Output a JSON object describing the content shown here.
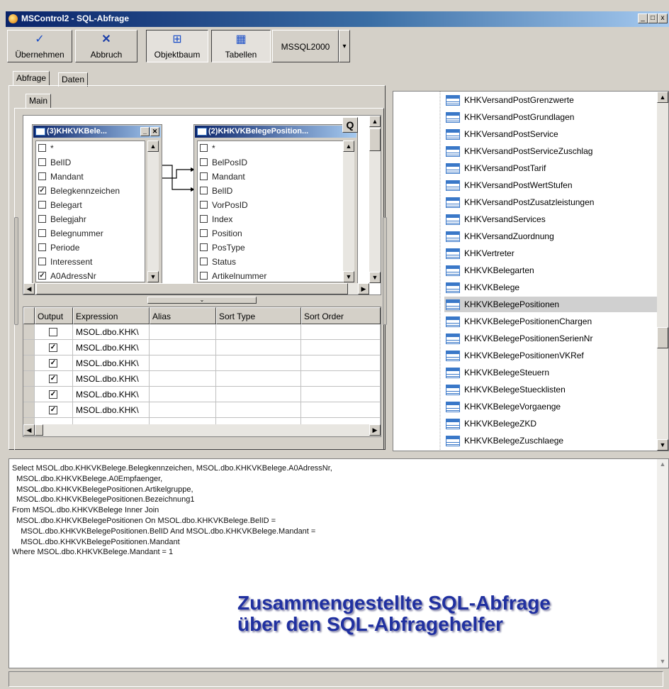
{
  "window": {
    "title": "MSControl2 - SQL-Abfrage",
    "min": "_",
    "max": "□",
    "close": "x"
  },
  "toolbar": {
    "apply_label": "Übernehmen",
    "cancel_label": "Abbruch",
    "objtree_label": "Objektbaum",
    "tables_label": "Tabellen",
    "db_value": "MSSQL2000",
    "dropdown_glyph": "▾"
  },
  "tabs": {
    "query": "Abfrage",
    "data": "Daten"
  },
  "inner_tab": "Main",
  "query_button": "Q",
  "table1": {
    "title": "(3)KHKVKBele...",
    "fields": [
      {
        "name": "*",
        "checked": false
      },
      {
        "name": "BelID",
        "checked": false
      },
      {
        "name": "Mandant",
        "checked": false
      },
      {
        "name": "Belegkennzeichen",
        "checked": true
      },
      {
        "name": "Belegart",
        "checked": false
      },
      {
        "name": "Belegjahr",
        "checked": false
      },
      {
        "name": "Belegnummer",
        "checked": false
      },
      {
        "name": "Periode",
        "checked": false
      },
      {
        "name": "Interessent",
        "checked": false
      },
      {
        "name": "A0AdressNr",
        "checked": true
      }
    ]
  },
  "table2": {
    "title": "(2)KHKVKBelegePosition...",
    "fields": [
      {
        "name": "*",
        "checked": false
      },
      {
        "name": "BelPosID",
        "checked": false
      },
      {
        "name": "Mandant",
        "checked": false
      },
      {
        "name": "BelID",
        "checked": false
      },
      {
        "name": "VorPosID",
        "checked": false
      },
      {
        "name": "Index",
        "checked": false
      },
      {
        "name": "Position",
        "checked": false
      },
      {
        "name": "PosType",
        "checked": false
      },
      {
        "name": "Status",
        "checked": false
      },
      {
        "name": "Artikelnummer",
        "checked": false
      }
    ]
  },
  "grid": {
    "columns": [
      "Output",
      "Expression",
      "Alias",
      "Sort Type",
      "Sort Order"
    ],
    "rows": [
      {
        "output": false,
        "expression": "MSOL.dbo.KHK\\"
      },
      {
        "output": true,
        "expression": "MSOL.dbo.KHK\\"
      },
      {
        "output": true,
        "expression": "MSOL.dbo.KHK\\"
      },
      {
        "output": true,
        "expression": "MSOL.dbo.KHK\\"
      },
      {
        "output": true,
        "expression": "MSOL.dbo.KHK\\"
      },
      {
        "output": true,
        "expression": "MSOL.dbo.KHK\\"
      }
    ]
  },
  "tree": {
    "items": [
      "KHKVersandPostGrenzwerte",
      "KHKVersandPostGrundlagen",
      "KHKVersandPostService",
      "KHKVersandPostServiceZuschlag",
      "KHKVersandPostTarif",
      "KHKVersandPostWertStufen",
      "KHKVersandPostZusatzleistungen",
      "KHKVersandServices",
      "KHKVersandZuordnung",
      "KHKVertreter",
      "KHKVKBelegarten",
      "KHKVKBelege",
      "KHKVKBelegePositionen",
      "KHKVKBelegePositionenChargen",
      "KHKVKBelegePositionenSerienNr",
      "KHKVKBelegePositionenVKRef",
      "KHKVKBelegeSteuern",
      "KHKVKBelegeStuecklisten",
      "KHKVKBelegeVorgaenge",
      "KHKVKBelegeZKD",
      "KHKVKBelegeZuschlaege"
    ],
    "selected": "KHKVKBelegePositionen"
  },
  "sql": {
    "text": "Select MSOL.dbo.KHKVKBelege.Belegkennzeichen, MSOL.dbo.KHKVKBelege.A0AdressNr,\n  MSOL.dbo.KHKVKBelege.A0Empfaenger,\n  MSOL.dbo.KHKVKBelegePositionen.Artikelgruppe,\n  MSOL.dbo.KHKVKBelegePositionen.Bezeichnung1\nFrom MSOL.dbo.KHKVKBelege Inner Join\n  MSOL.dbo.KHKVKBelegePositionen On MSOL.dbo.KHKVKBelege.BelID =\n    MSOL.dbo.KHKVKBelegePositionen.BelID And MSOL.dbo.KHKVKBelege.Mandant =\n    MSOL.dbo.KHKVKBelegePositionen.Mandant\nWhere MSOL.dbo.KHKVKBelege.Mandant = 1",
    "overlay_line1": "Zusammengestellte SQL-Abfrage",
    "overlay_line2": "über den SQL-Abfragehelfer"
  },
  "colors": {
    "accent": "#0a246a",
    "overlay": "#2030a0",
    "table_icon": "#3a78c8"
  }
}
